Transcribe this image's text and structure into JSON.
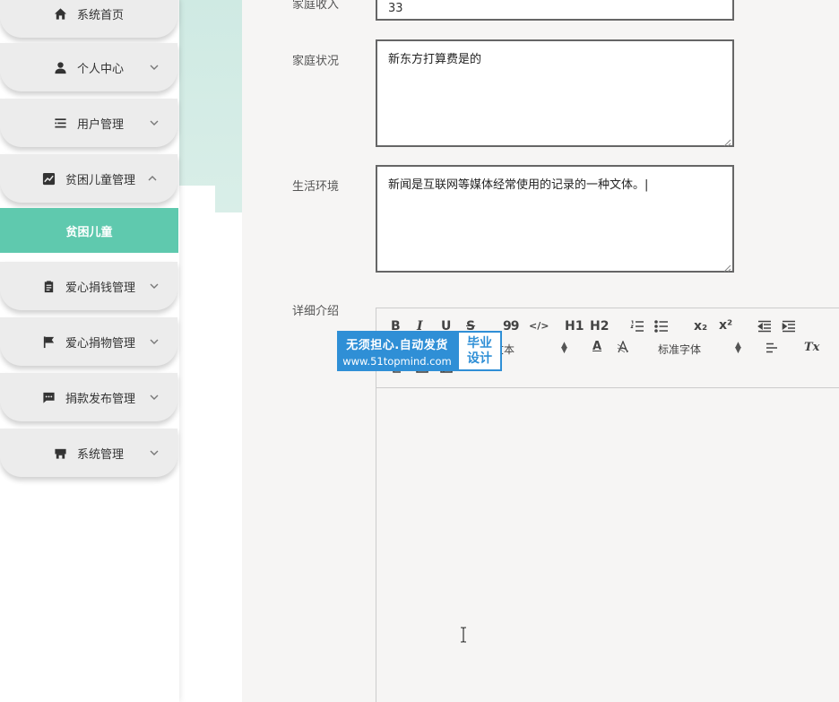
{
  "sidebar": {
    "items": [
      {
        "label": "系统首页",
        "icon": "home-icon",
        "expandable": false
      },
      {
        "label": "个人中心",
        "icon": "user-icon",
        "expandable": true
      },
      {
        "label": "用户管理",
        "icon": "list-icon",
        "expandable": true
      },
      {
        "label": "贫困儿童管理",
        "icon": "chart-icon",
        "expandable": true,
        "expanded": true
      },
      {
        "label": "爱心捐钱管理",
        "icon": "clipboard-icon",
        "expandable": true
      },
      {
        "label": "爱心捐物管理",
        "icon": "flag-icon",
        "expandable": true
      },
      {
        "label": "捐款发布管理",
        "icon": "message-icon",
        "expandable": true
      },
      {
        "label": "系统管理",
        "icon": "store-icon",
        "expandable": true
      }
    ],
    "submenu_active": "贫困儿童",
    "accent_color": "#5fc9ae"
  },
  "form": {
    "income_label": "家庭收入",
    "income_value": "33",
    "family_label": "家庭状况",
    "family_value": "新东方打算费是的",
    "environment_label": "生活环境",
    "environment_value": "新闻是互联网等媒体经常使用的记录的一种文体。|",
    "detail_label": "详细介绍"
  },
  "editor": {
    "toolbar": {
      "bold": "B",
      "italic": "I",
      "underline": "U",
      "strike": "S",
      "quote": "99",
      "code": "</>",
      "h1": "H1",
      "h2": "H2",
      "subscript": "x₂",
      "superscript": "x²",
      "size_select": "文本",
      "font_select": "标准字体",
      "color": "A",
      "clear_format": "Tx"
    }
  },
  "watermark": {
    "line1": "无须担心.自动发货",
    "line2": "www.51topmind.com",
    "side_line1": "毕业",
    "side_line2": "设计"
  }
}
